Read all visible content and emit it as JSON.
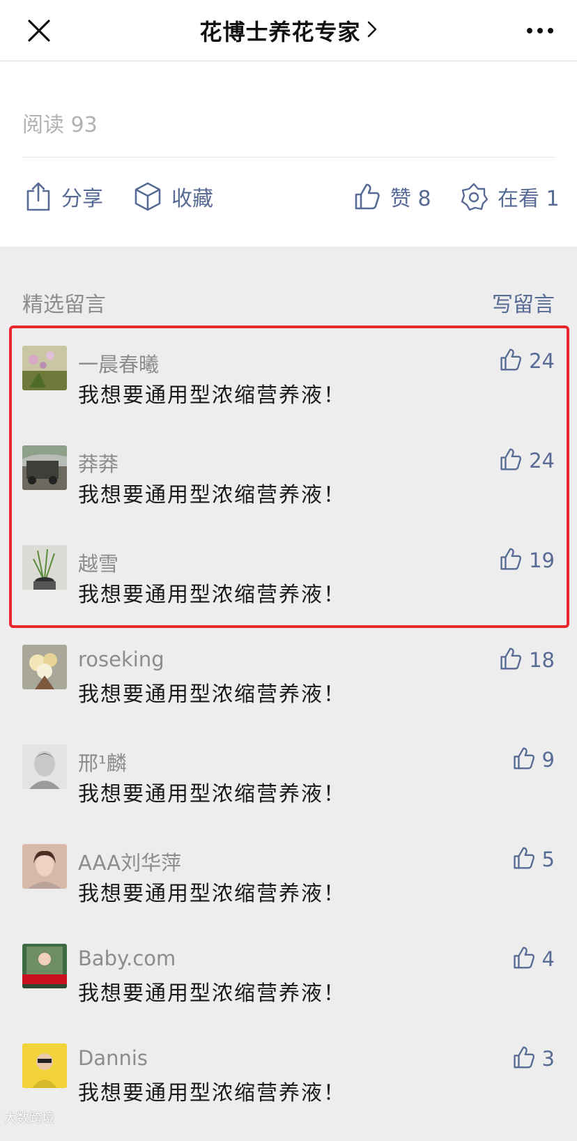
{
  "header": {
    "title": "花博士养花专家",
    "close_icon": "close-icon",
    "more_icon": "more-dots-icon"
  },
  "article": {
    "read_label": "阅读 93",
    "actions": {
      "share": "分享",
      "favorite": "收藏",
      "like": "赞 8",
      "watching": "在看 1"
    }
  },
  "comments": {
    "section_title": "精选留言",
    "write_label": "写留言",
    "highlight_color": "#e8262b",
    "items": [
      {
        "name": "一晨春曦",
        "text": "我想要通用型浓缩营养液！",
        "likes": "24"
      },
      {
        "name": "莽莽",
        "text": "我想要通用型浓缩营养液！",
        "likes": "24"
      },
      {
        "name": "越雪",
        "text": "我想要通用型浓缩营养液！",
        "likes": "19"
      },
      {
        "name": "roseking",
        "text": "我想要通用型浓缩营养液！",
        "likes": "18"
      },
      {
        "name": "邢¹麟",
        "text": "我想要通用型浓缩营养液！",
        "likes": "9"
      },
      {
        "name": "AAA刘华萍",
        "text": "我想要通用型浓缩营养液！",
        "likes": "5"
      },
      {
        "name": "Baby.com",
        "text": "我想要通用型浓缩营养液！",
        "likes": "4"
      },
      {
        "name": "Dannis",
        "text": "我想要通用型浓缩营养液！",
        "likes": "3"
      }
    ]
  },
  "colors": {
    "link_blue": "#576b95",
    "secondary_gray": "#8c8c8c",
    "background": "#ededed"
  },
  "watermark": "大数跨境"
}
